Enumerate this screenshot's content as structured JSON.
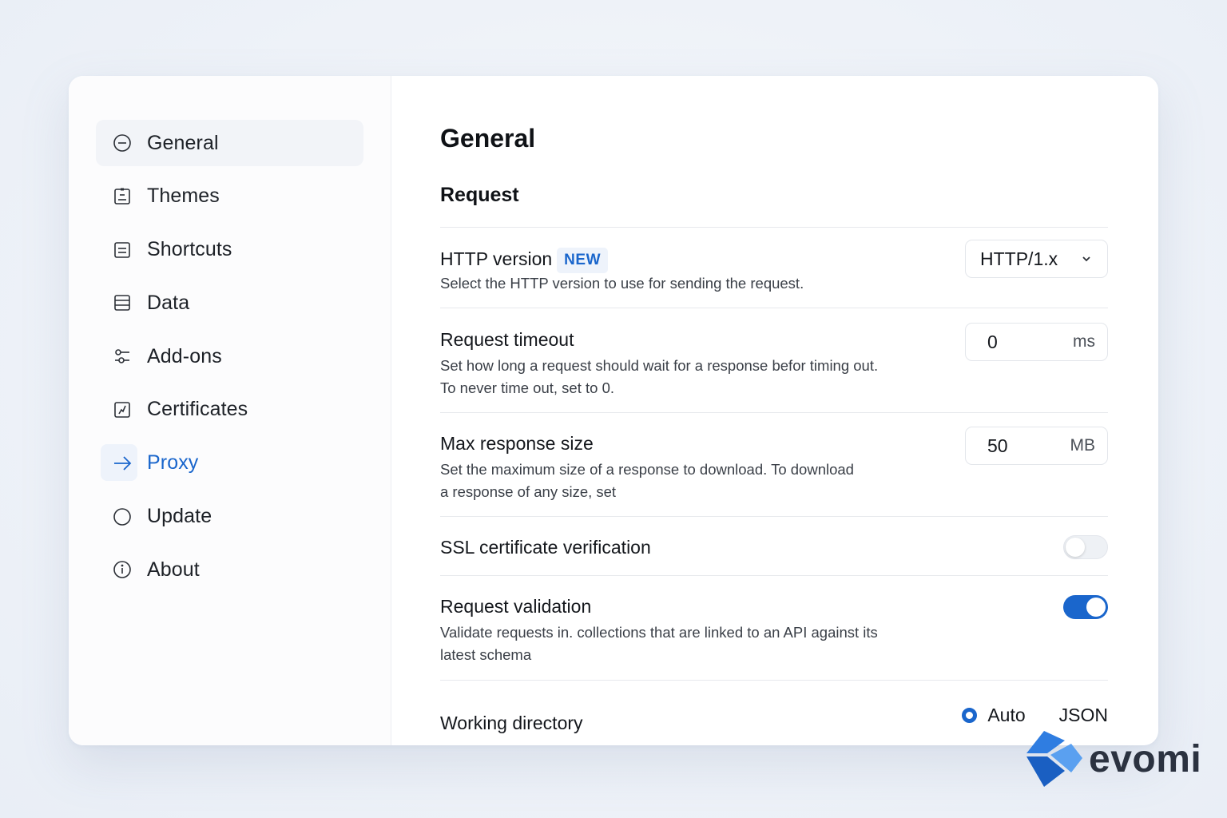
{
  "sidebar": {
    "items": [
      {
        "label": "General",
        "icon": "minus-circle-icon",
        "active": true
      },
      {
        "label": "Themes",
        "icon": "clipboard-icon"
      },
      {
        "label": "Shortcuts",
        "icon": "document-icon"
      },
      {
        "label": "Data",
        "icon": "database-icon"
      },
      {
        "label": "Add-ons",
        "icon": "sliders-icon"
      },
      {
        "label": "Certificates",
        "icon": "certificate-icon"
      },
      {
        "label": "Proxy",
        "icon": "arrow-right-icon",
        "highlighted": true
      },
      {
        "label": "Update",
        "icon": "circle-icon"
      },
      {
        "label": "About",
        "icon": "info-icon"
      }
    ]
  },
  "main": {
    "title": "General",
    "section": "Request",
    "http_version": {
      "title": "HTTP version",
      "badge": "NEW",
      "description": "Select the HTTP version to use for sending the request.",
      "value": "HTTP/1.x"
    },
    "request_timeout": {
      "title": "Request timeout",
      "description_line1": "Set how long a request should wait for a response befor timing out.",
      "description_line2": "To never time out, set to 0.",
      "value": "0",
      "unit": "ms"
    },
    "max_response_size": {
      "title": "Max response size",
      "description_line1": "Set the maximum size of a response to download. To download",
      "description_line2": "a response of any size, set",
      "value": "50",
      "unit": "MB"
    },
    "ssl_verification": {
      "title": "SSL certificate verification",
      "enabled": false
    },
    "request_validation": {
      "title": "Request validation",
      "description_line1": "Validate requests in. collections that are linked to an API against its",
      "description_line2": "latest schema",
      "enabled": true
    },
    "working_directory": {
      "title": "Working directory",
      "option1": "Auto",
      "option2": "JSON",
      "selected": "Auto"
    }
  },
  "brand": {
    "name": "evomi",
    "accent": "#1a66cc"
  }
}
